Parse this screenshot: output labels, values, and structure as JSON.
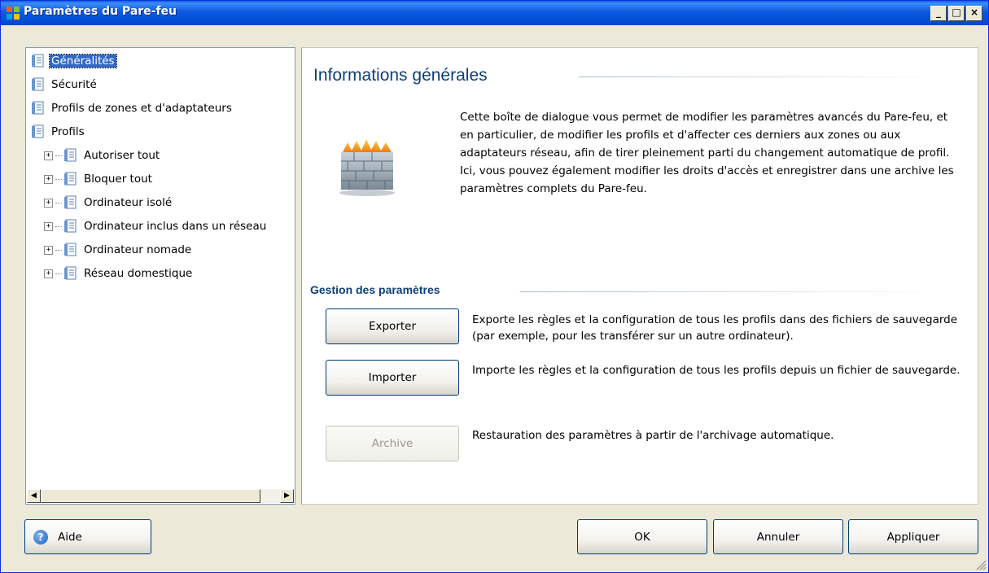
{
  "window": {
    "title": "Paramètres du Pare-feu",
    "controls": {
      "minimize": "_",
      "maximize": "□",
      "close": "×"
    }
  },
  "tree": {
    "items": [
      {
        "label": "Généralités",
        "selected": true,
        "expandable": false,
        "icon": "document-list-icon"
      },
      {
        "label": "Sécurité",
        "selected": false,
        "expandable": false,
        "icon": "document-list-icon"
      },
      {
        "label": "Profils de zones et d'adaptateurs",
        "selected": false,
        "expandable": false,
        "icon": "document-list-icon"
      },
      {
        "label": "Profils",
        "selected": false,
        "expandable": false,
        "icon": "document-list-icon"
      },
      {
        "label": "Autoriser tout",
        "selected": false,
        "expandable": true,
        "icon": "document-list-icon"
      },
      {
        "label": "Bloquer tout",
        "selected": false,
        "expandable": true,
        "icon": "document-list-icon"
      },
      {
        "label": "Ordinateur isolé",
        "selected": false,
        "expandable": true,
        "icon": "document-list-icon"
      },
      {
        "label": "Ordinateur inclus dans un réseau",
        "selected": false,
        "expandable": true,
        "icon": "document-list-icon"
      },
      {
        "label": "Ordinateur nomade",
        "selected": false,
        "expandable": true,
        "icon": "document-list-icon"
      },
      {
        "label": "Réseau domestique",
        "selected": false,
        "expandable": true,
        "icon": "document-list-icon"
      }
    ],
    "expander_symbol": "+"
  },
  "main": {
    "heading": "Informations générales",
    "description": "Cette boîte de dialogue vous permet de modifier les paramètres avancés du Pare-feu, et en particulier, de modifier les profils et d'affecter ces derniers aux zones ou aux adaptateurs réseau, afin de tirer pleinement parti du changement automatique de profil. Ici, vous pouvez également modifier les droits d'accès et enregistrer dans une archive les paramètres complets du Pare-feu.",
    "icon": "firewall-icon",
    "section_heading": "Gestion des paramètres",
    "actions": [
      {
        "label": "Exporter",
        "enabled": true,
        "description": "Exporte les règles et la configuration de tous les profils dans des fichiers de sauvegarde (par exemple, pour les transférer sur un autre ordinateur)."
      },
      {
        "label": "Importer",
        "enabled": true,
        "description": "Importe les règles et la configuration de tous les profils depuis un fichier de sauvegarde."
      },
      {
        "label": "Archive",
        "enabled": false,
        "description": "Restauration des paramètres à partir de l'archivage automatique."
      }
    ]
  },
  "footer": {
    "help_label": "Aide",
    "ok_label": "OK",
    "cancel_label": "Annuler",
    "apply_label": "Appliquer"
  },
  "colors": {
    "titlebar": "#0a5ae0",
    "heading": "#0d3f7a",
    "selection": "#316ac5",
    "window_bg": "#ece9d8"
  }
}
